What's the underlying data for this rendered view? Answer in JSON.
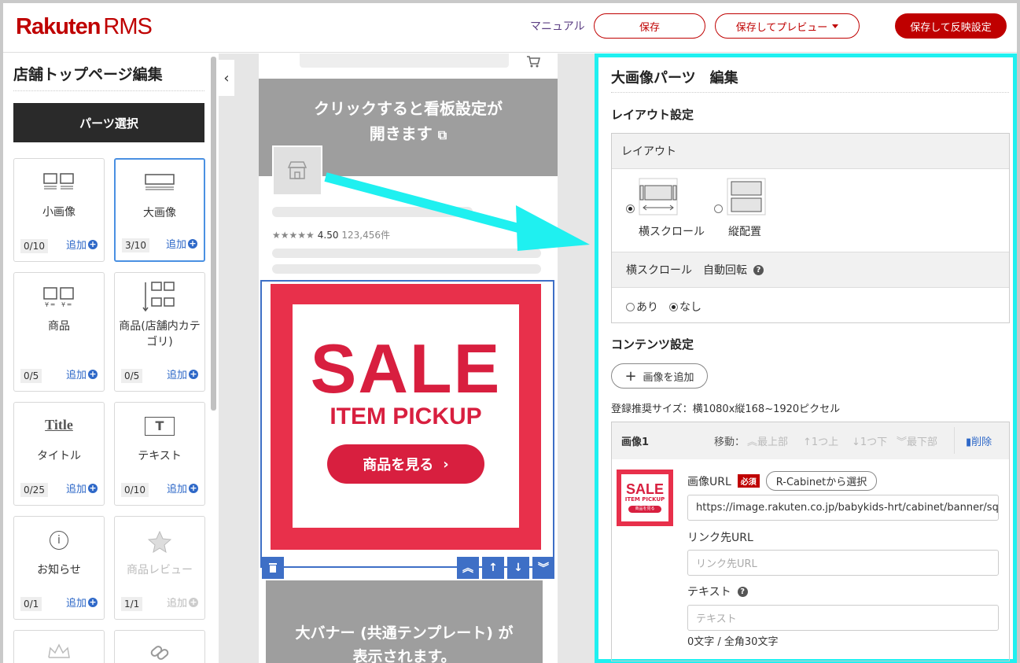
{
  "header": {
    "logo": "Rakuten",
    "logo_rms": "RMS",
    "manual": "マニュアル",
    "save": "保存",
    "save_preview": "保存してプレビュー",
    "save_apply": "保存して反映設定"
  },
  "left": {
    "title": "店舗トップページ編集",
    "parts_button": "パーツ選択",
    "cards": [
      {
        "label": "小画像",
        "count": "0/10",
        "add": "追加",
        "icon": "small-image-icon"
      },
      {
        "label": "大画像",
        "count": "3/10",
        "add": "追加",
        "icon": "large-image-icon"
      },
      {
        "label": "商品",
        "count": "0/5",
        "add": "追加",
        "icon": "product-icon"
      },
      {
        "label": "商品(店舗内カテゴリ)",
        "count": "0/5",
        "add": "追加",
        "icon": "category-product-icon"
      },
      {
        "label": "タイトル",
        "count": "0/25",
        "add": "追加",
        "icon": "title-icon"
      },
      {
        "label": "テキスト",
        "count": "0/10",
        "add": "追加",
        "icon": "text-icon"
      },
      {
        "label": "お知らせ",
        "count": "0/1",
        "add": "追加",
        "icon": "info-icon"
      },
      {
        "label": "商品レビュー",
        "count": "1/1",
        "add": "追加",
        "icon": "star-icon"
      }
    ],
    "title_icon_text": "Title",
    "text_icon_text": "T",
    "info_icon_text": "i"
  },
  "preview": {
    "banner_line1": "クリックすると看板設定が",
    "banner_line2": "開きます",
    "rating": "4.50",
    "review_count": "123,456件",
    "sale_big": "SALE",
    "sale_sub": "ITEM PICKUP",
    "sale_button": "商品を見る",
    "banner2_line1": "大バナー (共通テンプレート) が",
    "banner2_line2": "表示されます。"
  },
  "right": {
    "title": "大画像パーツ　編集",
    "layout_section": "レイアウト設定",
    "layout_label": "レイアウト",
    "opt_scroll": "横スクロール",
    "opt_vertical": "縦配置",
    "auto_rotate_label": "横スクロール　自動回転",
    "rot_yes": "あり",
    "rot_no": "なし",
    "content_section": "コンテンツ設定",
    "add_image": "画像を追加",
    "recommend": "登録推奨サイズ：横1080x縦168~1920ピクセル",
    "image_title": "画像1",
    "move_label": "移動：",
    "move_top": "最上部",
    "move_up": "1つ上",
    "move_down": "1つ下",
    "move_bottom": "最下部",
    "delete": "削除",
    "url_label": "画像URL",
    "required": "必須",
    "cabinet_button": "R-Cabinetから選択",
    "url_value": "https://image.rakuten.co.jp/babykids-hrt/cabinet/banner/squa",
    "link_label": "リンク先URL",
    "link_placeholder": "リンク先URL",
    "text_label": "テキスト",
    "text_placeholder": "テキスト",
    "char_count": "0文字 / 全角30文字",
    "thumb_sale": "SALE",
    "thumb_sub": "ITEM PICKUP",
    "thumb_btn": "商品を見る"
  },
  "colors": {
    "brand": "#bf0000",
    "accent": "#3e6fc6",
    "highlight": "#1ff0f0"
  }
}
